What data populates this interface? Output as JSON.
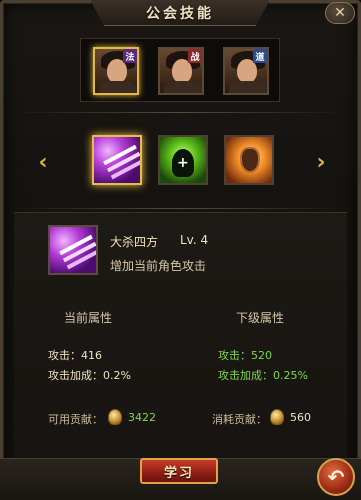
{
  "window": {
    "title": "公会技能",
    "close_icon": "close-icon"
  },
  "heroes": [
    {
      "tag": "法",
      "tag_color": "#5a2a7a",
      "selected": true
    },
    {
      "tag": "战",
      "tag_color": "#8a2a2a",
      "selected": false
    },
    {
      "tag": "道",
      "tag_color": "#2a4a8a",
      "selected": false
    }
  ],
  "skills_row": {
    "left_arrow": "‹",
    "right_arrow": "›"
  },
  "selected_skill": {
    "name": "大杀四方",
    "level": "Lv. 4",
    "description": "增加当前角色攻击"
  },
  "stats": {
    "current_header": "当前属性",
    "next_header": "下级属性",
    "current": [
      {
        "text": "攻击：416"
      },
      {
        "text": "攻击加成：0.2%"
      }
    ],
    "next": [
      {
        "text": "攻击：520"
      },
      {
        "text": "攻击加成：0.25%"
      }
    ]
  },
  "contribution": {
    "available_label": "可用贡献：",
    "available_value": "3422",
    "cost_label": "消耗贡献：",
    "cost_value": "560"
  },
  "actions": {
    "learn_label": "学习",
    "back_icon": "↶"
  },
  "colors": {
    "accent": "#e8bd46",
    "next_stat": "#7fd84c",
    "button_red": "#c43c2a"
  }
}
